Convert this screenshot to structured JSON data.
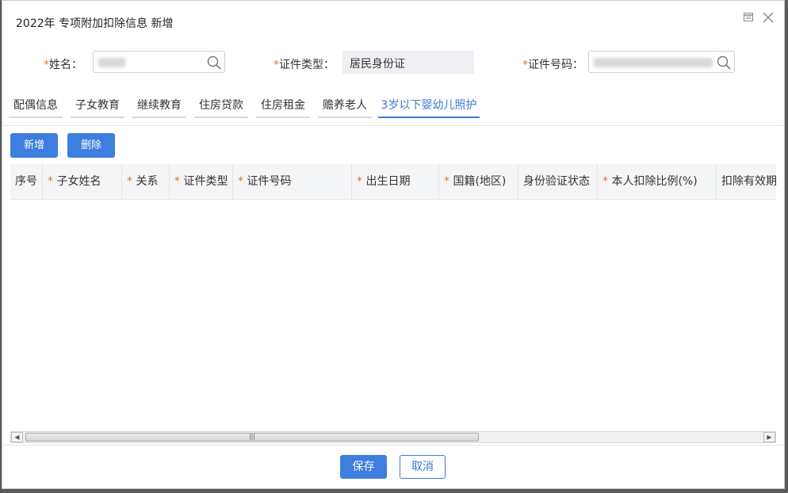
{
  "dialog": {
    "title": "2022年 专项附加扣除信息 新增"
  },
  "form": {
    "name_label": "姓名：",
    "name_value": "",
    "id_type_label": "证件类型：",
    "id_type_value": "居民身份证",
    "id_number_label": "证件号码：",
    "id_number_value": "",
    "required_mark": "*"
  },
  "tabs": [
    {
      "label": "配偶信息"
    },
    {
      "label": "子女教育"
    },
    {
      "label": "继续教育"
    },
    {
      "label": "住房贷款"
    },
    {
      "label": "住房租金"
    },
    {
      "label": "赡养老人"
    },
    {
      "label": "3岁以下婴幼儿照护",
      "active": true
    }
  ],
  "toolbar": {
    "add_label": "新增",
    "delete_label": "删除"
  },
  "table": {
    "columns": [
      {
        "label": "序号",
        "required": false
      },
      {
        "label": "子女姓名",
        "required": true
      },
      {
        "label": "关系",
        "required": true
      },
      {
        "label": "证件类型",
        "required": true
      },
      {
        "label": "证件号码",
        "required": true
      },
      {
        "label": "出生日期",
        "required": true
      },
      {
        "label": "国籍(地区)",
        "required": true
      },
      {
        "label": "身份验证状态",
        "required": false
      },
      {
        "label": "本人扣除比例(%)",
        "required": true
      },
      {
        "label": "扣除有效期",
        "required": false
      }
    ],
    "rows": []
  },
  "footer": {
    "save_label": "保存",
    "cancel_label": "取消"
  },
  "colors": {
    "primary": "#3d7ee0",
    "required": "#f56c2d",
    "tab_active": "#3a7bd5"
  }
}
